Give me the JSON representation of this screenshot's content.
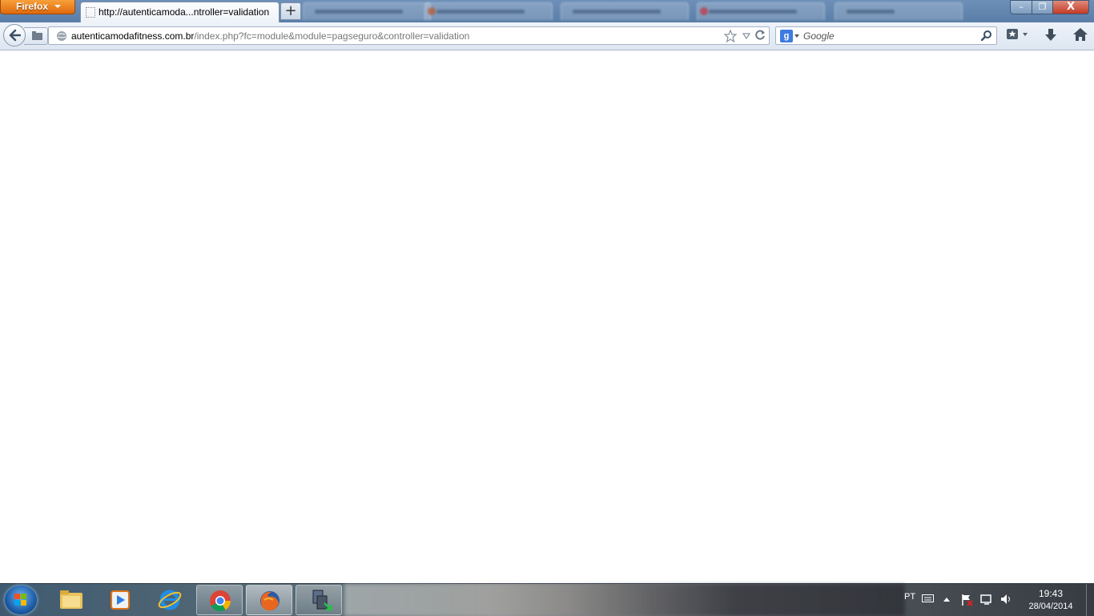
{
  "window": {
    "app_menu_label": "Firefox",
    "active_tab_title": "http://autenticamoda...ntroller=validation",
    "new_tab_symbol": "+",
    "minimize_symbol": "–",
    "maximize_symbol": "❐",
    "close_symbol": "X"
  },
  "navbar": {
    "url_domain": "autenticamodafitness.com.br",
    "url_path": "/index.php?fc=module&module=pagseguro&controller=validation",
    "search_placeholder": "Google",
    "search_engine_icon": "g"
  },
  "icons": {
    "back": "back-arrow-icon",
    "globe": "globe-icon",
    "bookmark_star": "star-icon",
    "reload": "reload-icon",
    "search": "magnifier-icon",
    "bookmarks": "bookmarks-icon",
    "downloads": "download-arrow-icon",
    "home": "home-icon"
  },
  "taskbar": {
    "language": "PT",
    "time": "19:43",
    "date": "28/04/2014"
  },
  "colors": {
    "firefox_button": "#e0690c",
    "titlebar": "#5a7ea8",
    "close_button": "#c43b24"
  }
}
